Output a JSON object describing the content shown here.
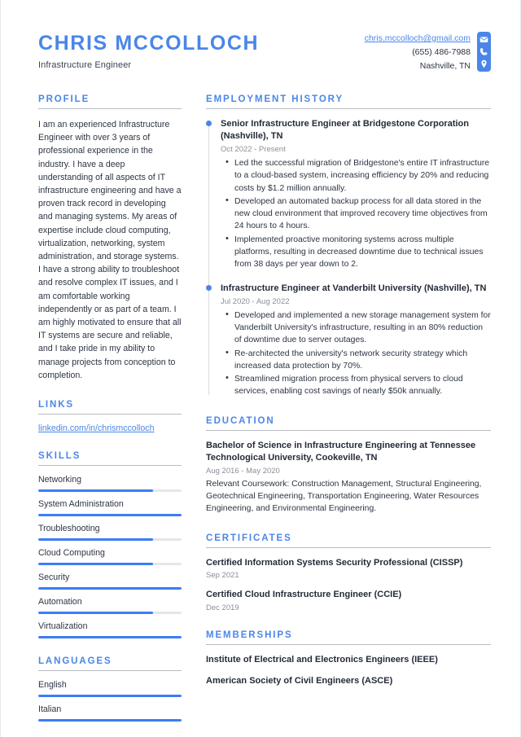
{
  "header": {
    "full_name": "CHRIS MCCOLLOCH",
    "job_title": "Infrastructure Engineer",
    "contact": {
      "email": "chris.mccolloch@gmail.com",
      "phone": "(655) 486-7988",
      "location": "Nashville, TN"
    },
    "icons": [
      "envelope-icon",
      "phone-icon",
      "location-pin-icon"
    ]
  },
  "colors": {
    "accent": "#4a86e8",
    "bar_fill": "#3b7df5",
    "bar_track": "#e4e6e8",
    "text": "#2c3443",
    "muted": "#8a8f98",
    "rule": "#b8bcc2"
  },
  "left": {
    "profile": {
      "title": "PROFILE",
      "text": "I am an experienced Infrastructure Engineer with over 3 years of professional experience in the industry. I have a deep understanding of all aspects of IT infrastructure engineering and have a proven track record in developing and managing systems. My areas of expertise include cloud computing, virtualization, networking, system administration, and storage systems. I have a strong ability to troubleshoot and resolve complex IT issues, and I am comfortable working independently or as part of a team. I am highly motivated to ensure that all IT systems are secure and reliable, and I take pride in my ability to manage projects from conception to completion."
    },
    "links": {
      "title": "LINKS",
      "items": [
        {
          "label": "linkedin.com/in/chrismccolloch"
        }
      ]
    },
    "skills": {
      "title": "SKILLS",
      "items": [
        {
          "label": "Networking",
          "level": 80
        },
        {
          "label": "System Administration",
          "level": 100
        },
        {
          "label": "Troubleshooting",
          "level": 80
        },
        {
          "label": "Cloud Computing",
          "level": 80
        },
        {
          "label": "Security",
          "level": 100
        },
        {
          "label": "Automation",
          "level": 80
        },
        {
          "label": "Virtualization",
          "level": 100
        }
      ]
    },
    "languages": {
      "title": "LANGUAGES",
      "items": [
        {
          "label": "English",
          "level": 100
        },
        {
          "label": "Italian",
          "level": 100
        }
      ]
    }
  },
  "right": {
    "employment": {
      "title": "EMPLOYMENT HISTORY",
      "items": [
        {
          "heading": "Senior Infrastructure Engineer at Bridgestone Corporation (Nashville), TN",
          "date": "Oct 2022 - Present",
          "bullets": [
            "Led the successful migration of Bridgestone's entire IT infrastructure to a cloud-based system, increasing efficiency by 20% and reducing costs by $1.2 million annually.",
            "Developed an automated backup process for all data stored in the new cloud environment that improved recovery time objectives from 24 hours to 4 hours.",
            "Implemented proactive monitoring systems across multiple platforms, resulting in decreased downtime due to technical issues from 38 days per year down to 2."
          ]
        },
        {
          "heading": "Infrastructure Engineer at Vanderbilt University (Nashville), TN",
          "date": "Jul 2020 - Aug 2022",
          "bullets": [
            "Developed and implemented a new storage management system for Vanderbilt University's infrastructure, resulting in an 80% reduction of downtime due to server outages.",
            "Re-architected the university's network security strategy which increased data protection by 70%.",
            "Streamlined migration process from physical servers to cloud services, enabling cost savings of nearly $50k annually."
          ]
        }
      ]
    },
    "education": {
      "title": "EDUCATION",
      "items": [
        {
          "heading": "Bachelor of Science in Infrastructure Engineering at Tennessee Technological University, Cookeville, TN",
          "date": "Aug 2016 - May 2020",
          "description": "Relevant Coursework: Construction Management, Structural Engineering, Geotechnical Engineering, Transportation Engineering, Water Resources Engineering, and Environmental Engineering."
        }
      ]
    },
    "certificates": {
      "title": "CERTIFICATES",
      "items": [
        {
          "heading": "Certified Information Systems Security Professional (CISSP)",
          "date": "Sep 2021"
        },
        {
          "heading": "Certified Cloud Infrastructure Engineer (CCIE)",
          "date": "Dec 2019"
        }
      ]
    },
    "memberships": {
      "title": "MEMBERSHIPS",
      "items": [
        {
          "heading": "Institute of Electrical and Electronics Engineers (IEEE)"
        },
        {
          "heading": "American Society of Civil Engineers (ASCE)"
        }
      ]
    }
  }
}
